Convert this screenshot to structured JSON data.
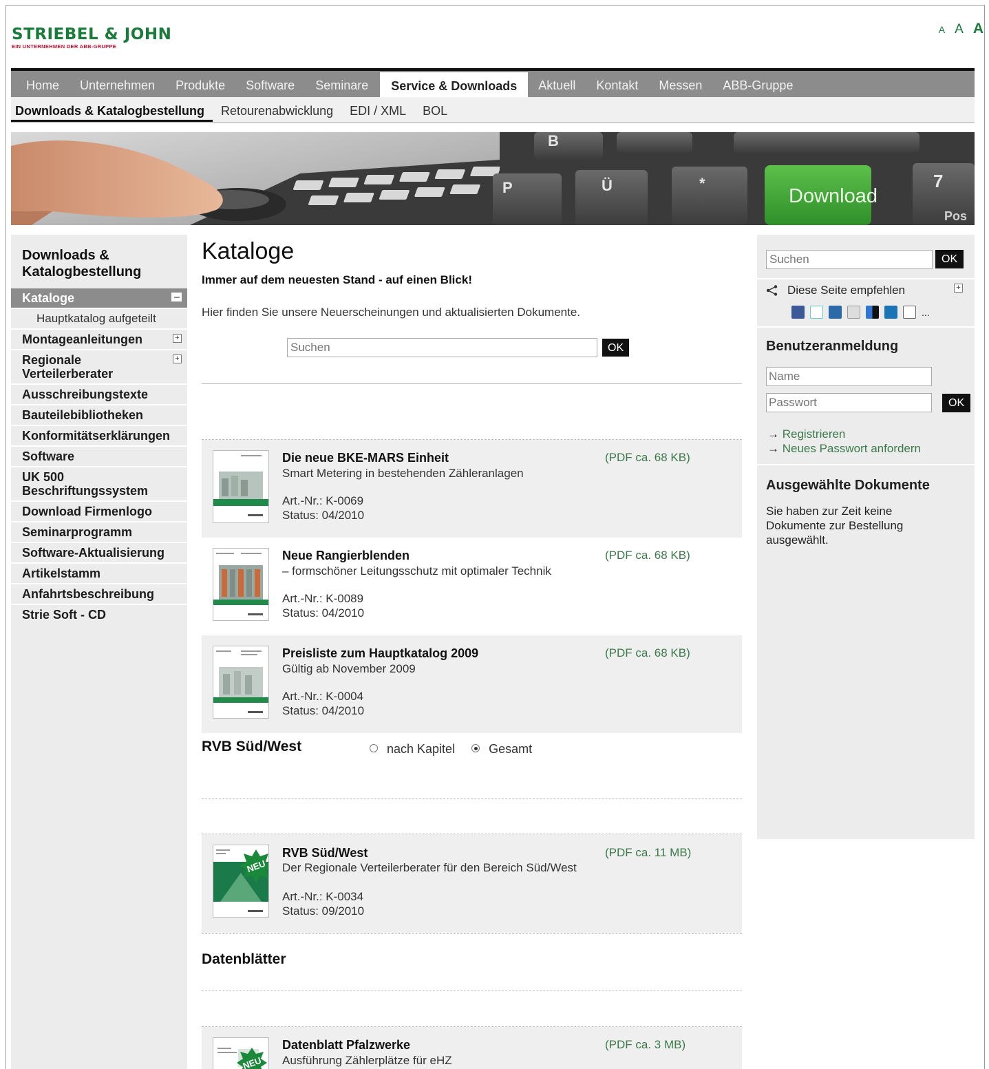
{
  "logo": {
    "main": "STRIEBEL & JOHN",
    "sub": "EIN UNTERNEHMEN DER ABB-GRUPPE"
  },
  "font_size_controls": [
    "A",
    "A",
    "A"
  ],
  "main_nav": [
    "Home",
    "Unternehmen",
    "Produkte",
    "Software",
    "Seminare",
    "Service & Downloads",
    "Aktuell",
    "Kontakt",
    "Messen",
    "ABB-Gruppe"
  ],
  "main_nav_active": "Service & Downloads",
  "sub_nav": [
    "Downloads & Katalogbestellung",
    "Retourenabwicklung",
    "EDI / XML",
    "BOL"
  ],
  "banner": {
    "keys": [
      "P",
      "Ü",
      "*",
      "B",
      "7",
      "Pos"
    ],
    "download_key": "Download",
    "pos_text": "Pos"
  },
  "left_nav": {
    "title": "Downloads & Katalogbestellung",
    "items": [
      {
        "label": "Kataloge",
        "state": "active"
      },
      {
        "label": "Hauptkatalog aufgeteilt",
        "state": "sub"
      },
      {
        "label": "Montageanleitungen",
        "state": "expandable"
      },
      {
        "label": "Regionale Verteilerberater",
        "state": "expandable"
      },
      {
        "label": "Ausschreibungstexte"
      },
      {
        "label": "Bauteilebibliotheken"
      },
      {
        "label": "Konformitätserklärungen"
      },
      {
        "label": "Software"
      },
      {
        "label": "UK 500 Beschriftungssystem"
      },
      {
        "label": "Download Firmenlogo"
      },
      {
        "label": "Seminarprogramm"
      },
      {
        "label": "Software-Aktualisierung"
      },
      {
        "label": "Artikelstamm"
      },
      {
        "label": "Anfahrtsbeschreibung"
      },
      {
        "label": "Strie Soft - CD"
      }
    ]
  },
  "content": {
    "title": "Kataloge",
    "lead": "Immer auf dem neuesten Stand - auf einen Blick!",
    "intro": "Hier finden Sie unsere Neuerscheinungen und aktualisierten Dokumente.",
    "search_placeholder": "Suchen",
    "ok_label": "OK",
    "catalogs": [
      {
        "title": "Die neue BKE-MARS Einheit",
        "subtitle": "Smart Metering in bestehenden Zähleranlagen",
        "art": "Art.-Nr.: K-0069",
        "status": "Status: 04/2010",
        "pdf": "(PDF ca. 68 KB)"
      },
      {
        "title": "Neue Rangierblenden",
        "subtitle": "– formschöner Leitungsschutz mit optimaler Technik",
        "art": "Art.-Nr.: K-0089",
        "status": "Status: 04/2010",
        "pdf": "(PDF ca. 68 KB)"
      },
      {
        "title": "Preisliste zum Hauptkatalog 2009",
        "subtitle": "Gültig ab November 2009",
        "art": "Art.-Nr.: K-0004",
        "status": "Status: 04/2010",
        "pdf": "(PDF ca. 68 KB)"
      }
    ],
    "rvb_section": {
      "title": "RVB Süd/West",
      "options": [
        "nach Kapitel",
        "Gesamt"
      ],
      "selected": "Gesamt"
    },
    "rvb_item": {
      "badge": "NEU",
      "title": "RVB Süd/West",
      "subtitle": "Der Regionale Verteilerberater für den Bereich Süd/West",
      "art": "Art.-Nr.: K-0034",
      "status": "Status: 09/2010",
      "pdf": "(PDF ca. 11 MB)"
    },
    "datasheet_section": {
      "title": "Datenblätter"
    },
    "datasheet_item": {
      "badge": "NEU",
      "title": "Datenblatt Pfalzwerke",
      "subtitle": "Ausführung Zählerplätze für eHZ",
      "pdf": "(PDF ca. 3 MB)"
    }
  },
  "right": {
    "search_placeholder": "Suchen",
    "ok_label": "OK",
    "recommend": "Diese Seite empfehlen",
    "social_more": "...",
    "login_title": "Benutzeranmeldung",
    "name_placeholder": "Name",
    "password_placeholder": "Passwort",
    "links": [
      "Registrieren",
      "Neues Passwort anfordern"
    ],
    "arrow": "→",
    "selected_docs_title": "Ausgewählte Dokumente",
    "selected_docs_text": "Sie haben zur Zeit keine Dokumente zur Bestellung ausgewählt."
  },
  "colors": {
    "brand_green": "#1a7a3a",
    "brand_red": "#c8102e",
    "nav_grey": "#8c8c8c",
    "link_green": "#3a7a4a"
  }
}
